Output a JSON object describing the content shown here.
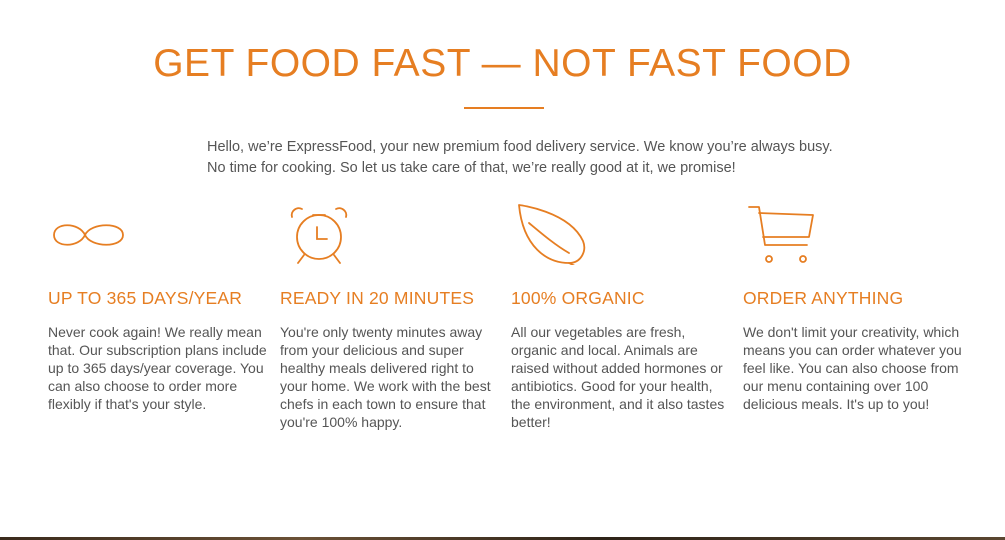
{
  "page": {
    "title": "GET FOOD FAST — NOT FAST FOOD",
    "intro": "Hello, we’re ExpressFood, your new premium food delivery service. We know you’re always busy. No time for cooking. So let us take care of that, we’re really good at it, we promise!"
  },
  "theme": {
    "accent": "#e67e22",
    "text": "#555555"
  },
  "features": [
    {
      "icon": "infinity-icon",
      "title": "UP TO 365 DAYS/YEAR",
      "text": "Never cook again! We really mean that. Our subscription plans include up to 365 days/year coverage. You can also choose to order more flexibly if that's your style."
    },
    {
      "icon": "alarm-clock-icon",
      "title": "READY IN 20 MINUTES",
      "text": "You're only twenty minutes away from your delicious and super healthy meals delivered right to your home. We work with the best chefs in each town to ensure that you're 100% happy."
    },
    {
      "icon": "leaf-icon",
      "title": "100% ORGANIC",
      "text": "All our vegetables are fresh, organic and local. Animals are raised without added hormones or antibiotics. Good for your health, the environment, and it also tastes better!"
    },
    {
      "icon": "shopping-cart-icon",
      "title": "ORDER ANYTHING",
      "text": "We don't limit your creativity, which means you can order whatever you feel like. You can also choose from our menu containing over 100 delicious meals. It's up to you!"
    }
  ]
}
